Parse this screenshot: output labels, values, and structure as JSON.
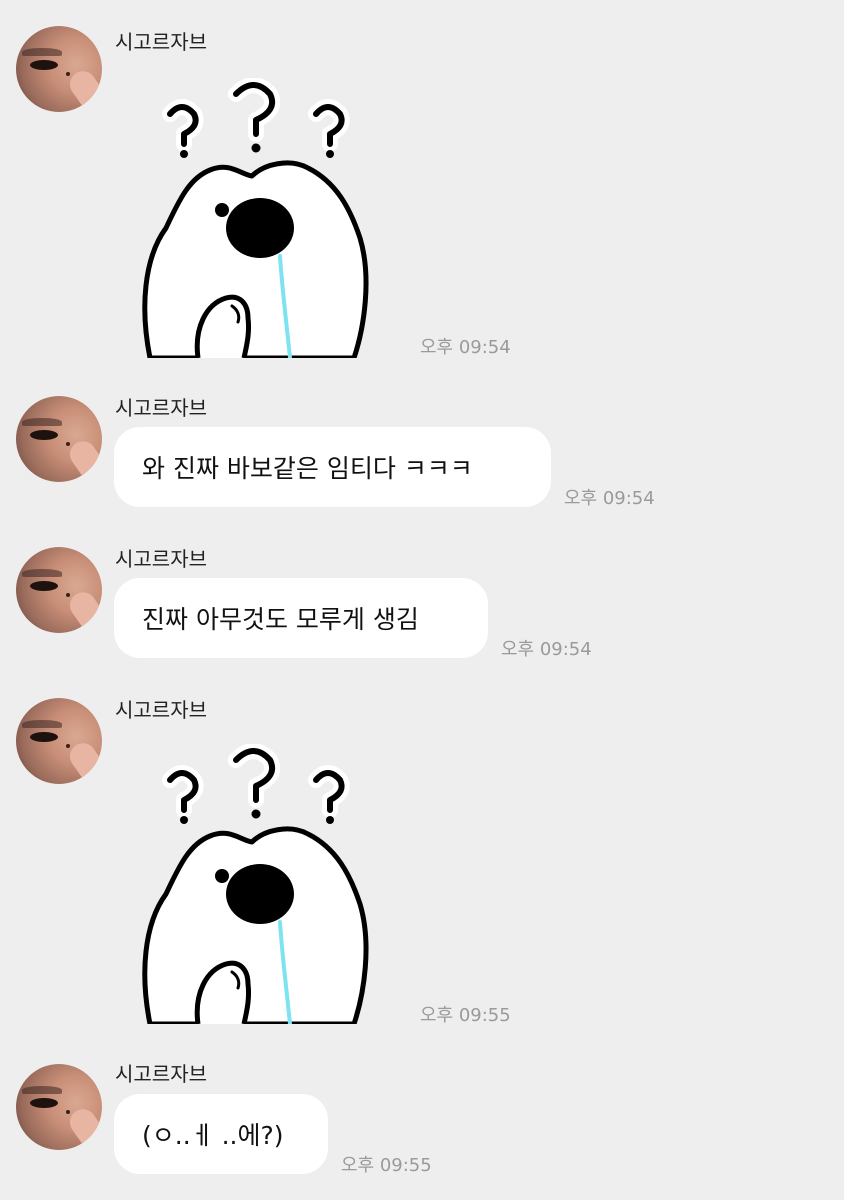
{
  "messages": [
    {
      "sender": "시고르자브",
      "type": "sticker",
      "sticker_icon": "confused-bear-sticker",
      "time": "오후 09:54"
    },
    {
      "sender": "시고르자브",
      "type": "text",
      "text": "와 진짜 바보같은 임티다 ㅋㅋㅋ",
      "time": "오후 09:54"
    },
    {
      "sender": "시고르자브",
      "type": "text",
      "text": "진짜 아무것도 모루게 생김",
      "time": "오후 09:54"
    },
    {
      "sender": "시고르자브",
      "type": "sticker",
      "sticker_icon": "confused-bear-sticker",
      "time": "오후 09:55"
    },
    {
      "sender": "시고르자브",
      "type": "text",
      "text": "(ㅇ..ㅔ ..에?)",
      "time": "오후 09:55"
    }
  ],
  "colors": {
    "background": "#eeeeee",
    "bubble": "#ffffff",
    "time_text": "#9a9a9a",
    "drool": "#7ee3f0"
  }
}
